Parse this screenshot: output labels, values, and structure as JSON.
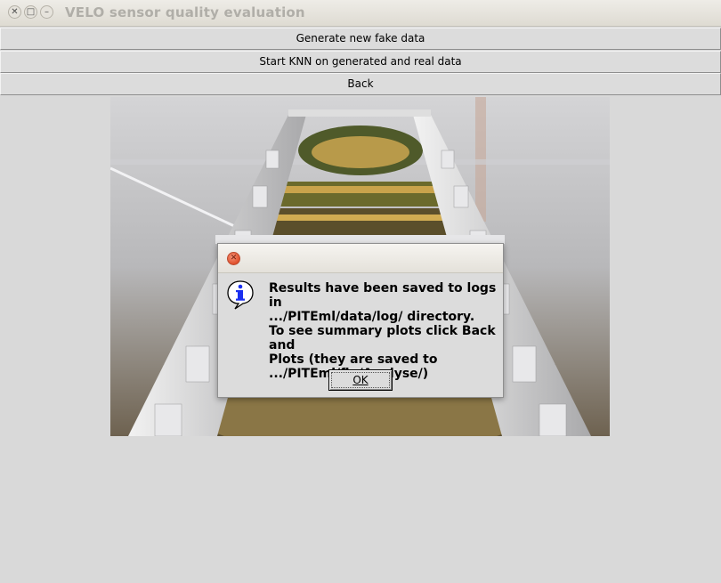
{
  "window": {
    "title": "VELO sensor quality evaluation",
    "controls": [
      "close-icon",
      "maximize-icon",
      "minimize-icon"
    ]
  },
  "buttons": {
    "generate": "Generate new fake data",
    "knn": "Start KNN on generated and real data",
    "back": "Back"
  },
  "dialog": {
    "message": "Results have been saved to logs in\n.../PITEml/data/log/ directory.\nTo see summary plots click Back and\nPlots (they are saved to\n.../PITEml/fig/Analyse/)",
    "ok_label": "OK",
    "icon": "info-icon"
  },
  "colors": {
    "background": "#d9d9d9",
    "dialog_close": "#e0502c",
    "info_icon": "#1a2ff0"
  }
}
